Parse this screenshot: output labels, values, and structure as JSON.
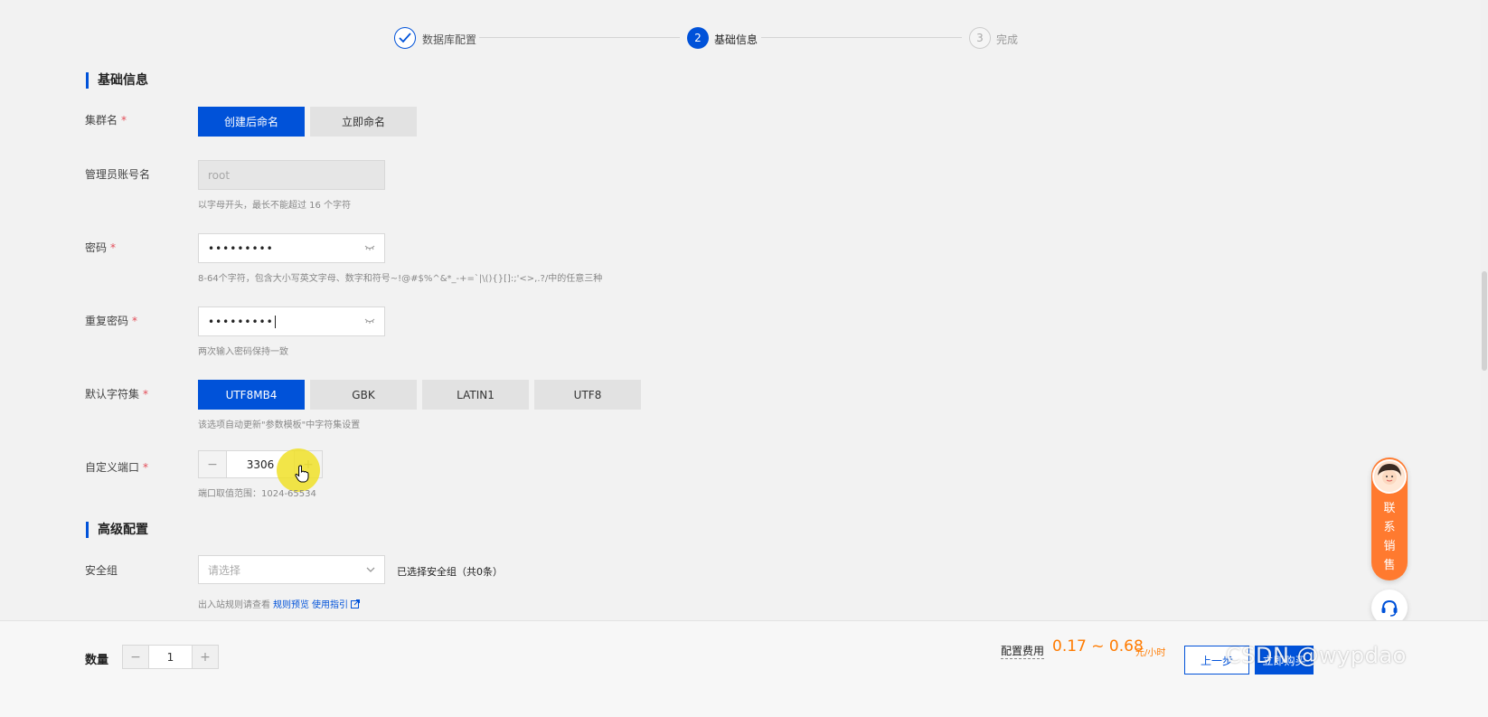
{
  "steps": [
    {
      "label": "数据库配置",
      "status": "done"
    },
    {
      "label": "基础信息",
      "number": "2",
      "status": "active"
    },
    {
      "label": "完成",
      "number": "3",
      "status": "pending"
    }
  ],
  "sections": {
    "basic": "基础信息",
    "advanced": "高级配置"
  },
  "form": {
    "cluster_name": {
      "label": "集群名",
      "options": [
        "创建后命名",
        "立即命名"
      ],
      "selected": "创建后命名"
    },
    "admin_account": {
      "label": "管理员账号名",
      "value": "root",
      "help": "以字母开头，最长不能超过 16 个字符"
    },
    "password": {
      "label": "密码",
      "value": "•••••••••",
      "help": "8-64个字符，包含大小写英文字母、数字和符号~!@#$%^&*_-+=`|\\(){}[]:;'<>,.?/中的任意三种"
    },
    "confirm_password": {
      "label": "重复密码",
      "value": "•••••••••",
      "help": "两次输入密码保持一致"
    },
    "charset": {
      "label": "默认字符集",
      "options": [
        "UTF8MB4",
        "GBK",
        "LATIN1",
        "UTF8"
      ],
      "selected": "UTF8MB4",
      "help": "该选项自动更新\"参数模板\"中字符集设置"
    },
    "port": {
      "label": "自定义端口",
      "value": "3306",
      "minus": "−",
      "plus": "+",
      "help": "端口取值范围：1024-65534"
    },
    "security_group": {
      "label": "安全组",
      "placeholder": "请选择",
      "selected_text": "已选择安全组（共0条）",
      "rule_prefix": "出入站规则请查看",
      "rule_link": "规则预览",
      "guide_link": "使用指引"
    }
  },
  "footer": {
    "qty_label": "数量",
    "qty_value": "1",
    "qty_minus": "−",
    "qty_plus": "+",
    "fee_label": "配置费用",
    "fee_value": "0.17 ~ 0.68",
    "fee_unit": "元/小时",
    "prev_button": "上一步",
    "buy_button": "立即购买",
    "watermark": "CSDN @wypdao"
  },
  "contact": {
    "text": [
      "联",
      "系",
      "销",
      "售"
    ]
  },
  "colors": {
    "primary": "#0052d9",
    "price": "#ff7b00",
    "contact": "#ff7a2f",
    "required": "#e34d59"
  }
}
